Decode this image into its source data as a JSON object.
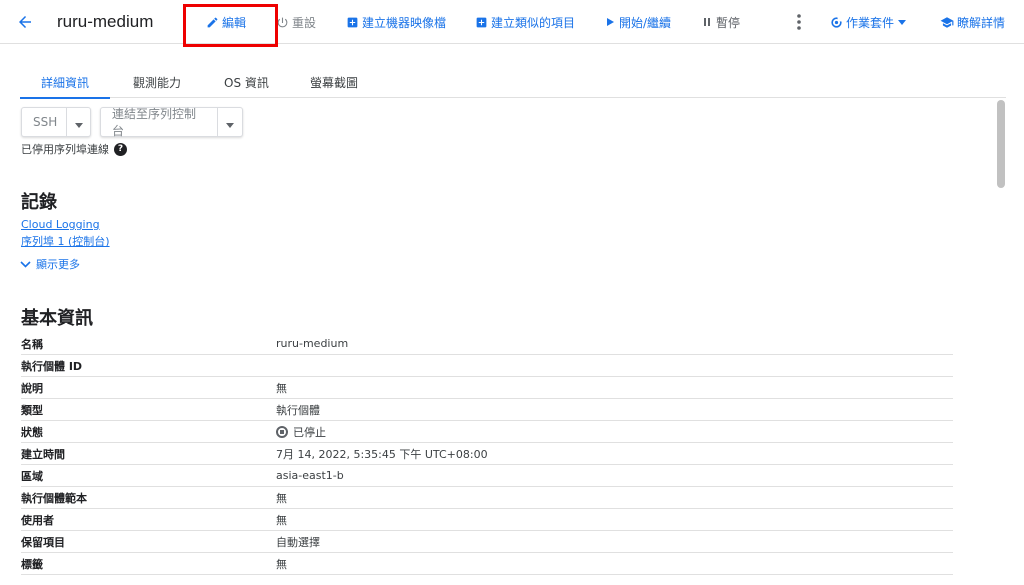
{
  "toolbar": {
    "title": "ruru-medium",
    "edit": "編輯",
    "reset": "重設",
    "create_image": "建立機器映像檔",
    "create_similar": "建立類似的項目",
    "start": "開始/繼續",
    "pause": "暫停",
    "ops_suite": "作業套件",
    "learn_more": "瞭解詳情"
  },
  "tabs": [
    "詳細資訊",
    "觀測能力",
    "OS 資訊",
    "螢幕截圖"
  ],
  "connect": {
    "ssh": "SSH",
    "serial": "連結至序列控制台",
    "serial_disabled_note": "已停用序列埠連線"
  },
  "logs": {
    "heading": "記錄",
    "cloud_logging": "Cloud Logging",
    "serial_port": "序列埠 1 (控制台)",
    "show_more": "顯示更多"
  },
  "basic_info": {
    "heading": "基本資訊",
    "rows": [
      {
        "label": "名稱",
        "value": "ruru-medium"
      },
      {
        "label": "執行個體 ID",
        "value": ""
      },
      {
        "label": "說明",
        "value": "無"
      },
      {
        "label": "類型",
        "value": "執行個體"
      },
      {
        "label": "狀態",
        "value": "已停止"
      },
      {
        "label": "建立時間",
        "value": "7月 14, 2022, 5:35:45 下午 UTC+08:00"
      },
      {
        "label": "區域",
        "value": "asia-east1-b"
      },
      {
        "label": "執行個體範本",
        "value": "無"
      },
      {
        "label": "使用者",
        "value": "無"
      },
      {
        "label": "保留項目",
        "value": "自動選擇"
      },
      {
        "label": "標籤",
        "value": "無"
      }
    ]
  },
  "colors": {
    "accent": "#1a73e8",
    "highlight": "#ee0000"
  }
}
